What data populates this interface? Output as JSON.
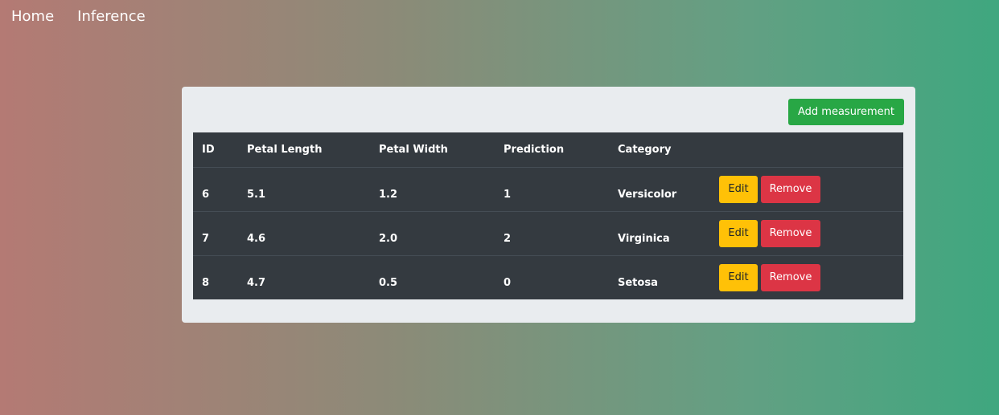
{
  "nav": {
    "home_label": "Home",
    "inference_label": "Inference"
  },
  "toolbar": {
    "add_label": "Add measurement"
  },
  "table": {
    "headers": {
      "id": "ID",
      "petal_length": "Petal Length",
      "petal_width": "Petal Width",
      "prediction": "Prediction",
      "category": "Category"
    },
    "rows": [
      {
        "id": "6",
        "petal_length": "5.1",
        "petal_width": "1.2",
        "prediction": "1",
        "category": "Versicolor",
        "edit_label": "Edit",
        "remove_label": "Remove"
      },
      {
        "id": "7",
        "petal_length": "4.6",
        "petal_width": "2.0",
        "prediction": "2",
        "category": "Virginica",
        "edit_label": "Edit",
        "remove_label": "Remove"
      },
      {
        "id": "8",
        "petal_length": "4.7",
        "petal_width": "0.5",
        "prediction": "0",
        "category": "Setosa",
        "edit_label": "Edit",
        "remove_label": "Remove"
      }
    ]
  },
  "colors": {
    "success": "#28a745",
    "warning": "#ffc107",
    "danger": "#dc3545",
    "table_dark": "#343a40",
    "card_bg": "#e9ecef"
  }
}
